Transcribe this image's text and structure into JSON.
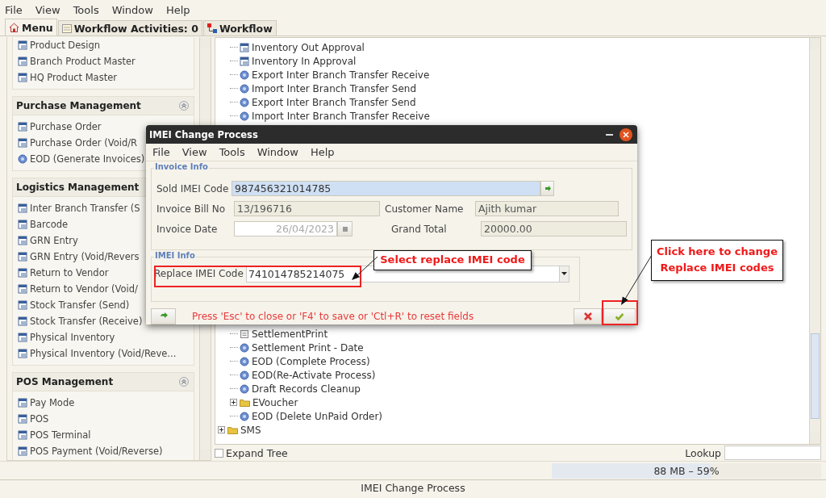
{
  "menu_bar": [
    "File",
    "View",
    "Tools",
    "Window",
    "Help"
  ],
  "tabs": [
    {
      "label": "Menu",
      "selected": true,
      "kind": "home"
    },
    {
      "label": "Workflow Activities: 0",
      "selected": false,
      "kind": "list"
    },
    {
      "label": "Workflow",
      "selected": false,
      "kind": "flow"
    }
  ],
  "sidebar": {
    "sections": [
      {
        "items": [
          {
            "label": "Product Design",
            "kind": "form"
          },
          {
            "label": "Branch Product Master",
            "kind": "form"
          },
          {
            "label": "HQ Product Master",
            "kind": "form"
          }
        ]
      },
      {
        "title": "Purchase Management",
        "items": [
          {
            "label": "Purchase Order",
            "kind": "form"
          },
          {
            "label": "Purchase Order (Void/R",
            "kind": "form"
          },
          {
            "label": "EOD (Generate Invoices)",
            "kind": "process"
          }
        ]
      },
      {
        "title": "Logistics Management",
        "items": [
          {
            "label": "Inter Branch Transfer (S",
            "kind": "form"
          },
          {
            "label": "Barcode",
            "kind": "form"
          },
          {
            "label": "GRN Entry",
            "kind": "form"
          },
          {
            "label": "GRN Entry (Void/Revers",
            "kind": "form"
          },
          {
            "label": "Return to Vendor",
            "kind": "form"
          },
          {
            "label": "Return to Vendor (Void/",
            "kind": "form"
          },
          {
            "label": "Stock Transfer (Send)",
            "kind": "form"
          },
          {
            "label": "Stock Transfer (Receive)",
            "kind": "form"
          },
          {
            "label": "Physical Inventory",
            "kind": "form"
          },
          {
            "label": "Physical Inventory (Void/Reve...",
            "kind": "form"
          }
        ]
      },
      {
        "title": "POS Management",
        "items": [
          {
            "label": "Pay Mode",
            "kind": "form"
          },
          {
            "label": "POS",
            "kind": "form"
          },
          {
            "label": "POS Terminal",
            "kind": "form"
          },
          {
            "label": "POS Payment (Void/Reverse)",
            "kind": "form"
          }
        ]
      }
    ]
  },
  "tree": {
    "nodes": [
      {
        "kind": "group",
        "children": [
          {
            "label": "Inventory Out Approval",
            "kind": "form"
          },
          {
            "label": "Inventory In Approval",
            "kind": "form"
          },
          {
            "label": "Export Inter Branch Transfer Receive",
            "kind": "process"
          },
          {
            "label": "Import Inter Branch Transfer Send",
            "kind": "process"
          },
          {
            "label": "Export Inter Branch Transfer Send",
            "kind": "process"
          },
          {
            "label": "Import Inter Branch Transfer Receive",
            "kind": "process"
          },
          {
            "label": "SettlementPrint",
            "kind": "report"
          },
          {
            "label": "Settlement Print - Date",
            "kind": "process"
          },
          {
            "label": "EOD (Complete Process)",
            "kind": "process"
          },
          {
            "label": "EOD(Re-Activate Process)",
            "kind": "process"
          },
          {
            "label": "Draft Records Cleanup",
            "kind": "process"
          },
          {
            "label": "EVoucher",
            "kind": "folder",
            "expanded": false
          },
          {
            "label": "EOD (Delete UnPaid Order)",
            "kind": "process"
          }
        ]
      },
      {
        "label": "SMS",
        "kind": "folder",
        "expanded": false
      }
    ]
  },
  "expand_tree": {
    "label": "Expand Tree",
    "checked": false
  },
  "lookup": {
    "label": "Lookup"
  },
  "memory": {
    "text": "88 MB – 59%",
    "level": 0.59
  },
  "status_bar": "IMEI Change Process",
  "dialog": {
    "title": "IMEI Change Process",
    "menu": [
      "File",
      "View",
      "Tools",
      "Window",
      "Help"
    ],
    "invoice_info": {
      "legend": "Invoice Info",
      "sold_imei": {
        "label": "Sold IMEI Code",
        "value": "987456321014785",
        "selected": true
      },
      "bill_no": {
        "label": "Invoice Bill No",
        "value": "13/196716",
        "disabled": true
      },
      "customer_name": {
        "label": "Customer Name",
        "value": "Ajith kumar",
        "disabled": true
      },
      "invoice_date": {
        "label": "Invoice Date",
        "value": "26/04/2023",
        "disabled": true
      },
      "grand_total": {
        "label": "Grand Total",
        "value": "20000.00",
        "disabled": true
      }
    },
    "imei_info": {
      "legend": "IMEI Info",
      "replace_imei": {
        "label": "Replace IMEI Code",
        "value": "741014785214075"
      }
    },
    "hint": "Press 'Esc' to close or 'F4' to save or 'Ctl+R' to reset fields"
  },
  "annotations": [
    {
      "text": "Select replace IMEI code"
    },
    {
      "text": "Click here to change\nReplace IMEI codes"
    }
  ]
}
